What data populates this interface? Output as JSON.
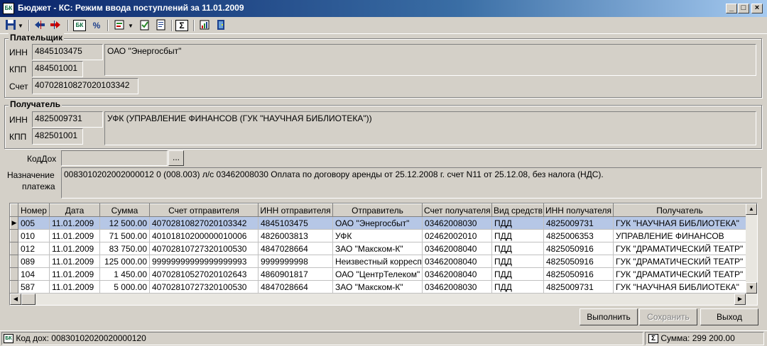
{
  "window": {
    "title": "Бюджет - КС: Режим ввода поступлений за 11.01.2009",
    "icon_text": "БК"
  },
  "payer": {
    "group_title": "Плательщик",
    "inn_label": "ИНН",
    "inn": "4845103475",
    "kpp_label": "КПП",
    "kpp": "484501001",
    "account_label": "Счет",
    "account": "40702810827020103342",
    "name": "ОАО \"Энергосбыт\""
  },
  "recipient": {
    "group_title": "Получатель",
    "inn_label": "ИНН",
    "inn": "4825009731",
    "kpp_label": "КПП",
    "kpp": "482501001",
    "name": "УФК (УПРАВЛЕНИЕ ФИНАНСОВ (ГУК \"НАУЧНАЯ БИБЛИОТЕКА\"))"
  },
  "kod_dox": {
    "label": "КодДох",
    "value": "",
    "button": "..."
  },
  "purpose": {
    "label_line1": "Назначение",
    "label_line2": "платежа",
    "text": "0083010202002000012 0 (008.003) л/с 03462008030 Оплата по договору аренды от 25.12.2008 г. счет N11 от 25.12.08, без налога (НДС)."
  },
  "table": {
    "headers": [
      "Номер",
      "Дата",
      "Сумма",
      "Счет отправителя",
      "ИНН отправителя",
      "Отправитель",
      "Счет получателя",
      "Вид средств",
      "ИНН получателя",
      "Получатель"
    ],
    "rows": [
      [
        "005",
        "11.01.2009",
        "12 500.00",
        "40702810827020103342",
        "4845103475",
        "ОАО \"Энергосбыт\"",
        "03462008030",
        "ПДД",
        "4825009731",
        "ГУК \"НАУЧНАЯ БИБЛИОТЕКА\""
      ],
      [
        "010",
        "11.01.2009",
        "71 500.00",
        "40101810200000010006",
        "4826003813",
        "УФК",
        "02462002010",
        "ПДД",
        "4825006353",
        "УПРАВЛЕНИЕ ФИНАНСОВ"
      ],
      [
        "012",
        "11.01.2009",
        "83 750.00",
        "40702810727320100530",
        "4847028664",
        "ЗАО \"Макском-К\"",
        "03462008040",
        "ПДД",
        "4825050916",
        "ГУК \"ДРАМАТИЧЕСКИЙ ТЕАТР\""
      ],
      [
        "089",
        "11.01.2009",
        "125 000.00",
        "99999999999999999993",
        "9999999998",
        "Неизвестный корресп",
        "03462008040",
        "ПДД",
        "4825050916",
        "ГУК \"ДРАМАТИЧЕСКИЙ ТЕАТР\""
      ],
      [
        "104",
        "11.01.2009",
        "1 450.00",
        "40702810527020102643",
        "4860901817",
        "ОАО \"ЦентрТелеком\"",
        "03462008040",
        "ПДД",
        "4825050916",
        "ГУК \"ДРАМАТИЧЕСКИЙ ТЕАТР\""
      ],
      [
        "587",
        "11.01.2009",
        "5 000.00",
        "40702810727320100530",
        "4847028664",
        "ЗАО \"Макском-К\"",
        "03462008030",
        "ПДД",
        "4825009731",
        "ГУК \"НАУЧНАЯ БИБЛИОТЕКА\""
      ]
    ],
    "selected_row": 0
  },
  "buttons": {
    "execute": "Выполнить",
    "save": "Сохранить",
    "exit": "Выход"
  },
  "status": {
    "icon_text": "БК",
    "kod_dox": "Код дох: 00830102020020000120",
    "sum_icon": "Σ",
    "sum": "Сумма: 299 200.00"
  },
  "toolbar": {
    "sum_symbol": "Σ",
    "percent_symbol": "%",
    "bk_text": "БК"
  },
  "colors": {
    "title_start": "#0a246a",
    "title_end": "#a6caf0",
    "selection": "#b6c7e6",
    "face": "#d4d0c8"
  }
}
